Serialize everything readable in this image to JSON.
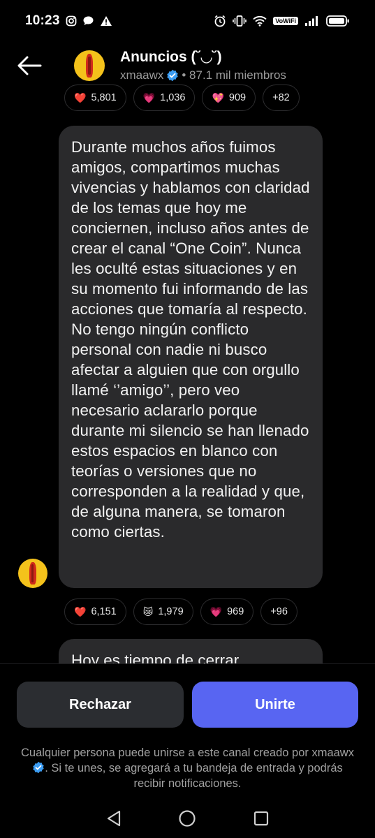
{
  "status_bar": {
    "time": "10:23",
    "wifi_label": "VoWiFi",
    "left_icons": [
      "instagram-icon",
      "chat-bubble-icon",
      "warning-icon"
    ],
    "right_icons": [
      "alarm-icon",
      "vibrate-icon",
      "wifi-icon",
      "vowifi-icon",
      "signal-icon",
      "battery-icon"
    ]
  },
  "header": {
    "title": "Anuncios (˘◡˘)",
    "owner": "xmaawx",
    "members": "• 87.1 mil miembros"
  },
  "top_reactions": [
    {
      "emoji": "❤️",
      "count": "5,801"
    },
    {
      "emoji": "💗",
      "count": "1,036"
    },
    {
      "emoji": "💖",
      "count": "909"
    },
    {
      "emoji": "",
      "count": "+82"
    }
  ],
  "message": {
    "text": "Durante muchos años fuimos amigos, compartimos muchas vivencias y hablamos con claridad de los temas que hoy me conciernen, incluso años antes de crear el canal “One Coin”. Nunca les oculté estas situaciones y en su momento fui informando de las acciones que tomaría al respecto. No tengo ningún conflicto personal con nadie ni busco afectar a alguien que con orgullo llamé ‘’amigo’’, pero veo necesario aclararlo porque durante mi silencio se han llenado estos espacios en blanco con teorías o versiones que no corresponden a la realidad y que, de alguna manera, se tomaron como ciertas."
  },
  "bottom_reactions": [
    {
      "emoji": "❤️",
      "count": "6,151"
    },
    {
      "emoji": "😿",
      "count": "1,979"
    },
    {
      "emoji": "💗",
      "count": "969"
    },
    {
      "emoji": "",
      "count": "+96"
    }
  ],
  "next_message": {
    "text": "Hoy es tiempo de cerrar"
  },
  "actions": {
    "reject_label": "Rechazar",
    "join_label": "Unirte"
  },
  "disclaimer": {
    "before": "Cualquier persona puede unirse a este canal creado por xmaawx",
    "after": ". Si te unes, se agregará a tu bandeja de entrada y podrás recibir notificaciones."
  },
  "colors": {
    "background": "#000000",
    "bubble": "#2a2a2c",
    "join_button": "#5865f2",
    "reject_button": "#2b2d31",
    "verified": "#3b9cf2"
  }
}
